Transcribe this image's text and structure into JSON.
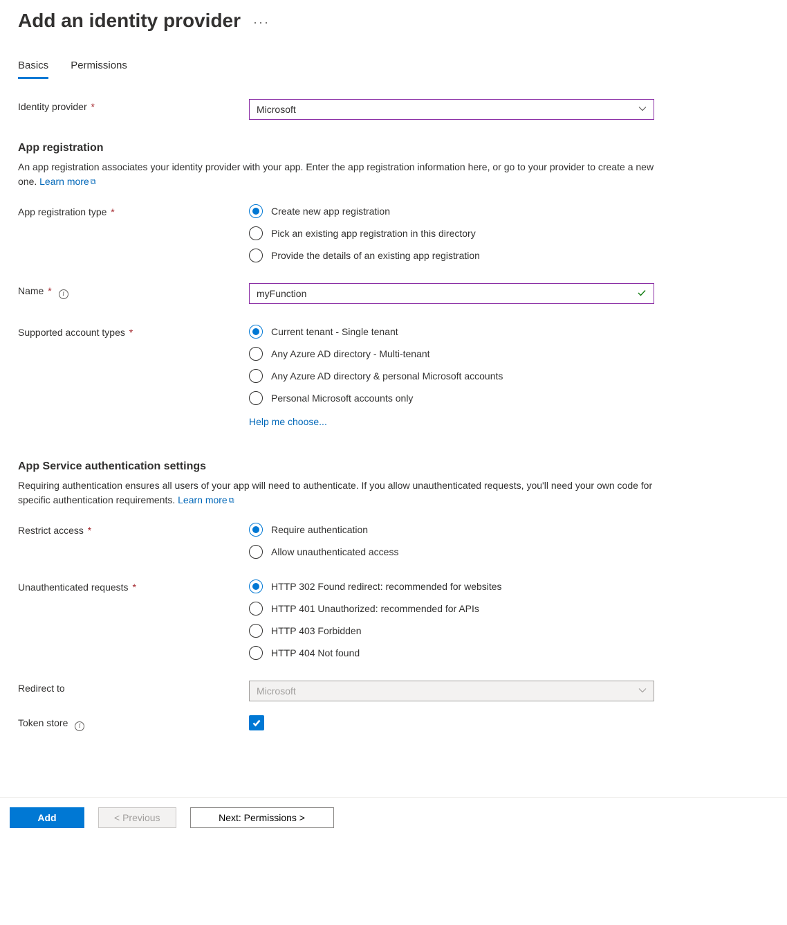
{
  "header": {
    "title": "Add an identity provider"
  },
  "tabs": {
    "basics": "Basics",
    "permissions": "Permissions"
  },
  "identity_provider": {
    "label": "Identity provider",
    "value": "Microsoft"
  },
  "app_registration": {
    "heading": "App registration",
    "desc_a": "An app registration associates your identity provider with your app. Enter the app registration information here, or go to your provider to create a new one. ",
    "learn_more": "Learn more",
    "type_label": "App registration type",
    "options": {
      "create": "Create new app registration",
      "pick": "Pick an existing app registration in this directory",
      "provide": "Provide the details of an existing app registration"
    },
    "name_label": "Name",
    "name_value": "myFunction",
    "account_types_label": "Supported account types",
    "account_options": {
      "current": "Current tenant - Single tenant",
      "any_ad": "Any Azure AD directory - Multi-tenant",
      "any_ad_personal": "Any Azure AD directory & personal Microsoft accounts",
      "personal": "Personal Microsoft accounts only"
    },
    "help_me_choose": "Help me choose..."
  },
  "auth_settings": {
    "heading": "App Service authentication settings",
    "desc": "Requiring authentication ensures all users of your app will need to authenticate. If you allow unauthenticated requests, you'll need your own code for specific authentication requirements. ",
    "learn_more": "Learn more",
    "restrict_label": "Restrict access",
    "restrict_options": {
      "require": "Require authentication",
      "allow": "Allow unauthenticated access"
    },
    "unauth_label": "Unauthenticated requests",
    "unauth_options": {
      "h302": "HTTP 302 Found redirect: recommended for websites",
      "h401": "HTTP 401 Unauthorized: recommended for APIs",
      "h403": "HTTP 403 Forbidden",
      "h404": "HTTP 404 Not found"
    },
    "redirect_label": "Redirect to",
    "redirect_value": "Microsoft",
    "token_store_label": "Token store"
  },
  "footer": {
    "add": "Add",
    "prev": "< Previous",
    "next": "Next: Permissions >"
  }
}
